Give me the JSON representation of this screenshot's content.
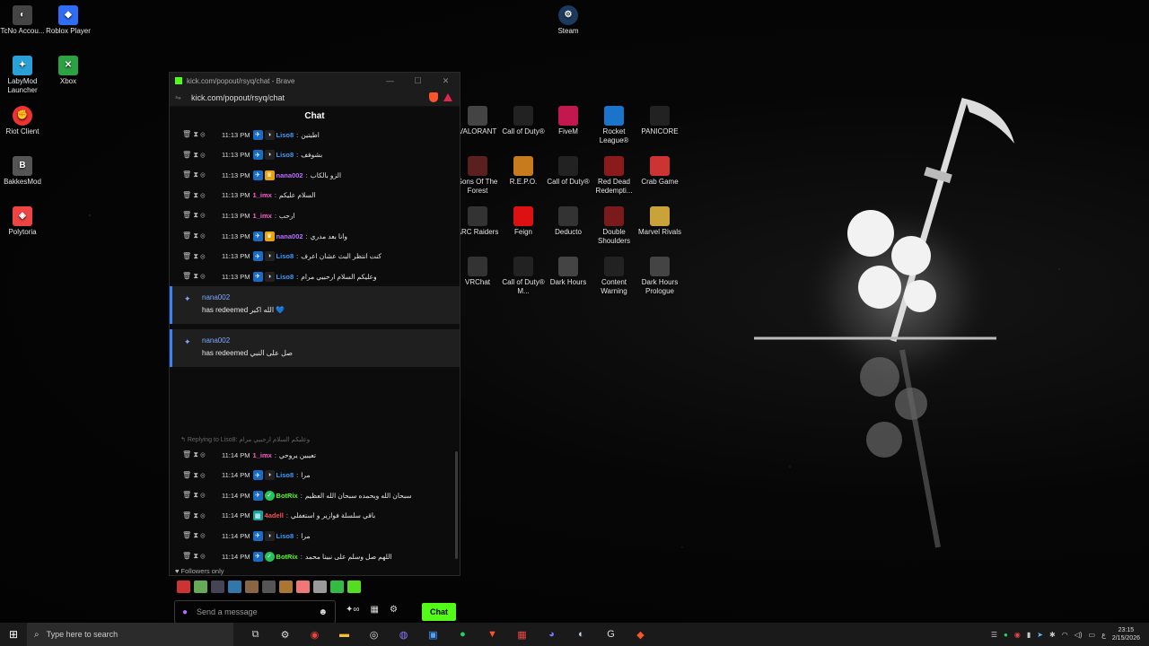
{
  "desktop": {
    "icons_left": [
      {
        "label": "TcNo Accou...",
        "color": "#444",
        "glyph": "◐"
      },
      {
        "label": "Roblox Player",
        "color": "#2f6df6",
        "glyph": "◆"
      },
      {
        "label": "LabyMod Launcher",
        "color": "#2aa0d8",
        "glyph": "✦"
      },
      {
        "label": "Xbox",
        "color": "#2ca243",
        "glyph": "✕"
      },
      {
        "label": "Riot Client",
        "color": "#e33",
        "glyph": "✊"
      },
      {
        "label": "BakkesMod",
        "color": "#555",
        "glyph": "B"
      },
      {
        "label": "Polytoria",
        "color": "#e44",
        "glyph": "◈"
      }
    ],
    "steam": {
      "label": "Steam"
    },
    "grid": [
      [
        "VALORANT",
        "Call of Duty®",
        "FiveM",
        "Rocket League®",
        "PANICORE"
      ],
      [
        "Sons Of The Forest",
        "R.E.P.O.",
        "Call of Duty®",
        "Red Dead Redempti...",
        "Crab Game"
      ],
      [
        "ARC Raiders",
        "Feign",
        "Deducto",
        "Double Shoulders",
        "Marvel Rivals"
      ],
      [
        "VRChat",
        "Call of Duty® M...",
        "Dark Hours",
        "Content Warning",
        "Dark Hours Prologue"
      ]
    ],
    "grid_colors": [
      [
        "#444",
        "#222",
        "#c2184f",
        "#1a74c9",
        "#222"
      ],
      [
        "#5a2020",
        "#c77b1c",
        "#222",
        "#8b1a1a",
        "#cc3333"
      ],
      [
        "#333",
        "#d11",
        "#333",
        "#7a1a1a",
        "#c9a23a"
      ],
      [
        "#333",
        "#222",
        "#444",
        "#222",
        "#444"
      ]
    ]
  },
  "window": {
    "title": "kick.com/popout/rsyq/chat - Brave",
    "url": "kick.com/popout/rsyq/chat",
    "header": "Chat",
    "controls": [
      "—",
      "☐",
      "✕"
    ]
  },
  "messages_top": [
    {
      "time": "11:13 PM",
      "badges": [
        "blue",
        "dark"
      ],
      "user": "Liso8",
      "color": "#3b9cff",
      "text": "اطيتين"
    },
    {
      "time": "11:13 PM",
      "badges": [
        "blue",
        "dark"
      ],
      "user": "Liso8",
      "color": "#3b9cff",
      "text": "بشوفف"
    },
    {
      "time": "11:13 PM",
      "badges": [
        "blue",
        "gold"
      ],
      "user": "nana002",
      "color": "#b66cff",
      "text": "الزو بالكاب"
    },
    {
      "time": "11:13 PM",
      "badges": [],
      "user": "1_imx",
      "color": "#ff5ad0",
      "text": "السلام عليكم"
    },
    {
      "time": "11:13 PM",
      "badges": [],
      "user": "1_imx",
      "color": "#ff5ad0",
      "text": "ارحب"
    },
    {
      "time": "11:13 PM",
      "badges": [
        "blue",
        "gold"
      ],
      "user": "nana002",
      "color": "#b66cff",
      "text": "وانا بعد مدري"
    },
    {
      "time": "11:13 PM",
      "badges": [
        "blue",
        "dark"
      ],
      "user": "Liso8",
      "color": "#3b9cff",
      "text": "كنت انتظر البث عشان اعرف"
    },
    {
      "time": "11:13 PM",
      "badges": [
        "blue",
        "dark"
      ],
      "user": "Liso8",
      "color": "#3b9cff",
      "text": "وعليكم السلام ارحبيي مرام"
    }
  ],
  "redeems": [
    {
      "user": "nana002",
      "text": "has redeemed الله اكبر 💙"
    },
    {
      "user": "nana002",
      "text": "has redeemed صل على النبي"
    }
  ],
  "reply_label": "Replying to Liso8: وعليكم السلام ارحبيي مرام",
  "messages_bottom": [
    {
      "time": "11:14 PM",
      "badges": [],
      "user": "1_imx",
      "color": "#ff5ad0",
      "text": "تعيبين يروحي"
    },
    {
      "time": "11:14 PM",
      "badges": [
        "blue",
        "dark"
      ],
      "user": "Liso8",
      "color": "#3b9cff",
      "text": "مرا"
    },
    {
      "time": "11:14 PM",
      "badges": [
        "blue",
        "green"
      ],
      "user": "BotRix",
      "color": "#53fc18",
      "text": "سبحان الله وبحمده سبحان الله العظيم"
    },
    {
      "time": "11:14 PM",
      "badges": [
        "teal"
      ],
      "user": "4adell",
      "color": "#ff4d4d",
      "text": "باقي سلسلة فوازير و استغفلي"
    },
    {
      "time": "11:14 PM",
      "badges": [
        "blue",
        "dark"
      ],
      "user": "Liso8",
      "color": "#3b9cff",
      "text": "مرا"
    },
    {
      "time": "11:14 PM",
      "badges": [
        "blue",
        "green"
      ],
      "user": "BotRix",
      "color": "#53fc18",
      "text": "اللهم صل وسلم على نبينا محمد"
    }
  ],
  "followers_only": "Followers only",
  "input": {
    "placeholder": "Send a message"
  },
  "chat_button": "Chat",
  "taskbar": {
    "search_placeholder": "Type here to search",
    "time": "23:15",
    "date": "2/15/2026",
    "lang": "ع"
  }
}
